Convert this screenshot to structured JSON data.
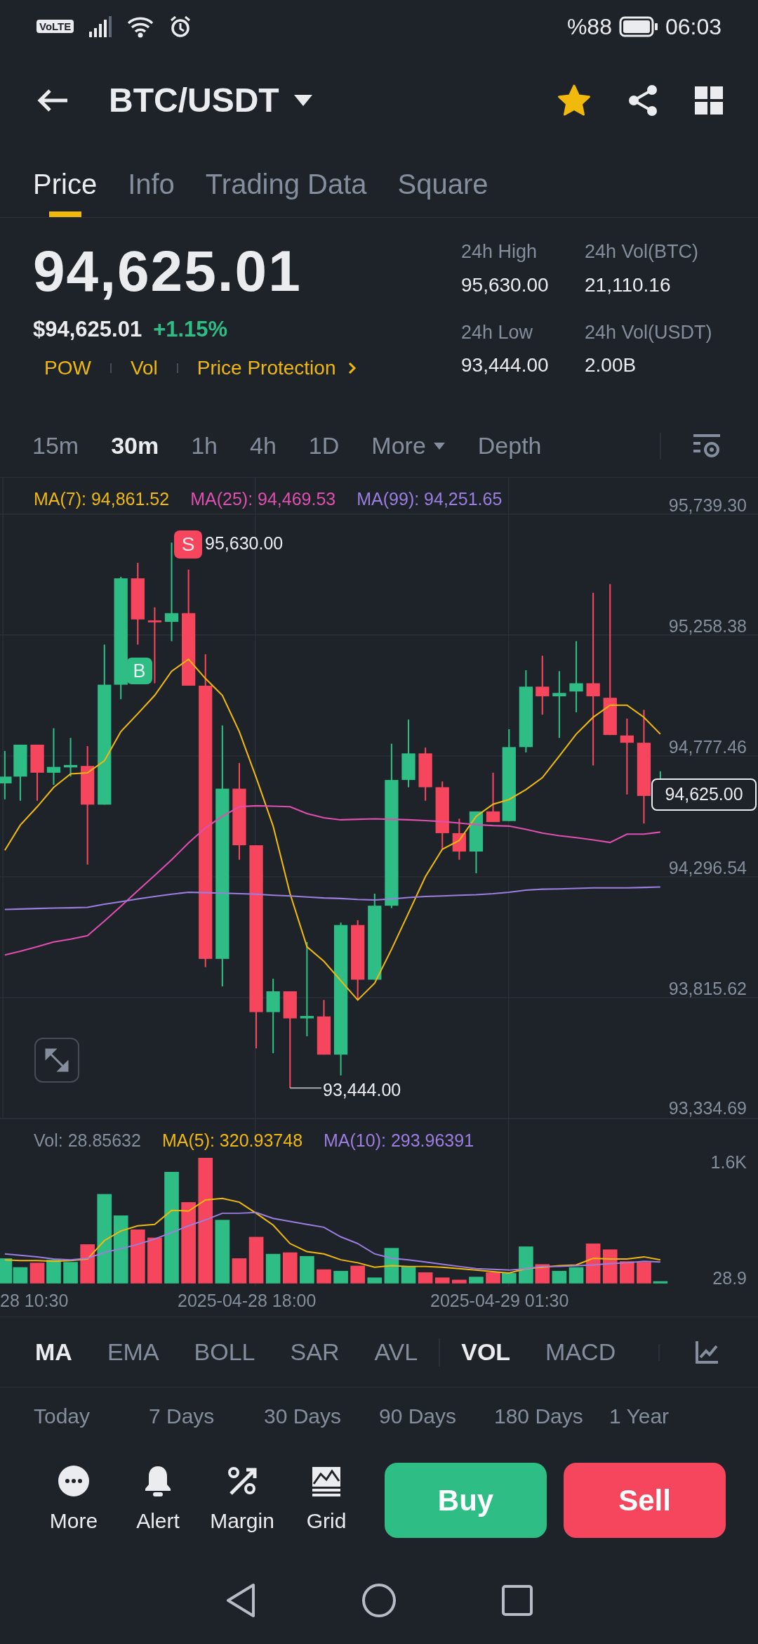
{
  "status_bar": {
    "network_badge": "VoLTE",
    "battery": "%88",
    "time": "06:03"
  },
  "header": {
    "title": "BTC/USDT",
    "favorited": true
  },
  "tabs": [
    {
      "label": "Price",
      "selected": true
    },
    {
      "label": "Info",
      "selected": false
    },
    {
      "label": "Trading Data",
      "selected": false
    },
    {
      "label": "Square",
      "selected": false
    }
  ],
  "price": {
    "last": "94,625.01",
    "fiat": "$94,625.01",
    "change": "+1.15%",
    "tags": [
      "POW",
      "Vol",
      "Price Protection"
    ]
  },
  "stats": [
    {
      "label": "24h High",
      "value": "95,630.00"
    },
    {
      "label": "24h Vol(BTC)",
      "value": "21,110.16"
    },
    {
      "label": "24h Low",
      "value": "93,444.00"
    },
    {
      "label": "24h Vol(USDT)",
      "value": "2.00B"
    }
  ],
  "intervals": [
    {
      "label": "15m",
      "selected": false,
      "kind": "interval"
    },
    {
      "label": "30m",
      "selected": true,
      "kind": "interval"
    },
    {
      "label": "1h",
      "selected": false,
      "kind": "interval"
    },
    {
      "label": "4h",
      "selected": false,
      "kind": "interval"
    },
    {
      "label": "1D",
      "selected": false,
      "kind": "interval"
    },
    {
      "label": "More",
      "selected": false,
      "kind": "menu"
    },
    {
      "label": "Depth",
      "selected": false,
      "kind": "interval"
    }
  ],
  "chart": {
    "ma_legend": [
      {
        "label": "MA(7): 94,861.52",
        "color": "#f0b90b"
      },
      {
        "label": "MA(25): 94,469.53",
        "color": "#e04fb0"
      },
      {
        "label": "MA(99): 94,251.65",
        "color": "#9c7de0"
      }
    ],
    "sell_marker": "S",
    "high_label": "95,630.00",
    "buy_marker": "B",
    "low_label": "93,444.00",
    "current_price": "94,625.00",
    "chart_data": {
      "type": "line",
      "grid": true,
      "ylim": [
        93334.69,
        95884
      ],
      "yticks": [
        {
          "value": 95739.3,
          "label": "95,739.30"
        },
        {
          "value": 95258.38,
          "label": "95,258.38"
        },
        {
          "value": 94777.46,
          "label": "94,777.46"
        },
        {
          "value": 94296.54,
          "label": "94,296.54"
        },
        {
          "value": 93815.62,
          "label": "93,815.62"
        },
        {
          "value": 93334.69,
          "label": "93,334.69"
        }
      ],
      "series": [
        {
          "color": "#f0b90b",
          "values": [
            94402,
            94502,
            94575,
            94652,
            94706,
            94710,
            94758,
            94874,
            94945,
            95018,
            95114,
            95162,
            95085,
            95018,
            94874,
            94691,
            94498,
            94229,
            94018,
            93960,
            93883,
            93806,
            93873,
            94008,
            94152,
            94297,
            94406,
            94441,
            94537,
            94585,
            94604,
            94643,
            94691,
            94777,
            94864,
            94931,
            94979,
            94979,
            94931,
            94864
          ]
        },
        {
          "color": "#e04fb0",
          "values": [
            93985,
            94000,
            94018,
            94037,
            94048,
            94062,
            94120,
            94179,
            94241,
            94302,
            94364,
            94431,
            94491,
            94537,
            94575,
            94579,
            94577,
            94575,
            94548,
            94531,
            94523,
            94525,
            94527,
            94525,
            94523,
            94520,
            94516,
            94510,
            94504,
            94500,
            94498,
            94485,
            94470,
            94460,
            94452,
            94443,
            94433,
            94466,
            94466,
            94474
          ]
        },
        {
          "color": "#9c7de0",
          "values": [
            94166,
            94168,
            94170,
            94172,
            94173,
            94175,
            94187,
            94197,
            94208,
            94218,
            94227,
            94235,
            94233,
            94231,
            94229,
            94227,
            94223,
            94220,
            94216,
            94212,
            94210,
            94206,
            94204,
            94208,
            94214,
            94218,
            94220,
            94223,
            94225,
            94229,
            94235,
            94243,
            94247,
            94248,
            94250,
            94252,
            94252,
            94252,
            94254,
            94256
          ]
        }
      ]
    }
  },
  "volume": {
    "legend": [
      {
        "label": "Vol: 28.85632",
        "color": "#848e9c"
      },
      {
        "label": "MA(5): 320.93748",
        "color": "#f0b90b"
      },
      {
        "label": "MA(10): 293.96391",
        "color": "#9c7de0"
      }
    ],
    "chart_data": {
      "type": "bar",
      "ylim": [
        -40,
        2223
      ],
      "yticks": [
        {
          "value": 1600,
          "label": "1.6K"
        },
        {
          "value": 28.9,
          "label": "28.9"
        }
      ],
      "series": [
        {
          "type": "bar",
          "values": [
            340,
            220,
            280,
            320,
            290,
            530,
            1210,
            920,
            730,
            620,
            1510,
            1100,
            1700,
            860,
            340,
            630,
            400,
            420,
            370,
            190,
            170,
            240,
            80,
            480,
            230,
            150,
            80,
            50,
            90,
            150,
            140,
            500,
            260,
            170,
            220,
            540,
            460,
            300,
            290,
            30
          ],
          "colors": [
            "#2ebd85",
            "#2ebd85",
            "#f6465d",
            "#2ebd85",
            "#2ebd85",
            "#f6465d",
            "#2ebd85",
            "#2ebd85",
            "#f6465d",
            "#f6465d",
            "#2ebd85",
            "#f6465d",
            "#f6465d",
            "#2ebd85",
            "#f6465d",
            "#f6465d",
            "#2ebd85",
            "#f6465d",
            "#2ebd85",
            "#f6465d",
            "#2ebd85",
            "#f6465d",
            "#2ebd85",
            "#2ebd85",
            "#2ebd85",
            "#f6465d",
            "#f6465d",
            "#f6465d",
            "#2ebd85",
            "#f6465d",
            "#2ebd85",
            "#2ebd85",
            "#f6465d",
            "#2ebd85",
            "#2ebd85",
            "#f6465d",
            "#f6465d",
            "#f6465d",
            "#f6465d",
            "#2ebd85"
          ]
        },
        {
          "type": "line",
          "color": "#f0b90b",
          "values": [
            320,
            310,
            310,
            300,
            310,
            330,
            580,
            710,
            780,
            800,
            990,
            980,
            1130,
            1150,
            1100,
            950,
            790,
            540,
            430,
            400,
            320,
            280,
            220,
            240,
            230,
            230,
            220,
            200,
            180,
            160,
            140,
            200,
            220,
            240,
            250,
            340,
            330,
            330,
            360,
            320
          ]
        },
        {
          "type": "line",
          "color": "#9c7de0",
          "values": [
            400,
            380,
            360,
            330,
            320,
            340,
            420,
            470,
            530,
            600,
            690,
            780,
            860,
            950,
            950,
            960,
            880,
            840,
            800,
            760,
            630,
            540,
            400,
            340,
            320,
            290,
            260,
            230,
            200,
            190,
            180,
            200,
            230,
            230,
            240,
            250,
            270,
            280,
            300,
            290
          ]
        }
      ]
    }
  },
  "time_axis": [
    "28 10:30",
    "2025-04-28 18:00",
    "2025-04-29 01:30"
  ],
  "indicators": [
    {
      "label": "MA",
      "selected": true
    },
    {
      "label": "EMA",
      "selected": false
    },
    {
      "label": "BOLL",
      "selected": false
    },
    {
      "label": "SAR",
      "selected": false
    },
    {
      "label": "AVL",
      "selected": false
    },
    {
      "label": "VOL",
      "selected": true
    },
    {
      "label": "MACD",
      "selected": false
    }
  ],
  "ranges": [
    "Today",
    "7 Days",
    "30 Days",
    "90 Days",
    "180 Days",
    "1 Year"
  ],
  "actions": [
    {
      "label": "More",
      "kind": "more"
    },
    {
      "label": "Alert",
      "kind": "alert"
    },
    {
      "label": "Margin",
      "kind": "margin"
    },
    {
      "label": "Grid",
      "kind": "grid"
    }
  ],
  "trade_buttons": [
    {
      "label": "Buy",
      "kind": "buy"
    },
    {
      "label": "Sell",
      "kind": "sell"
    }
  ]
}
